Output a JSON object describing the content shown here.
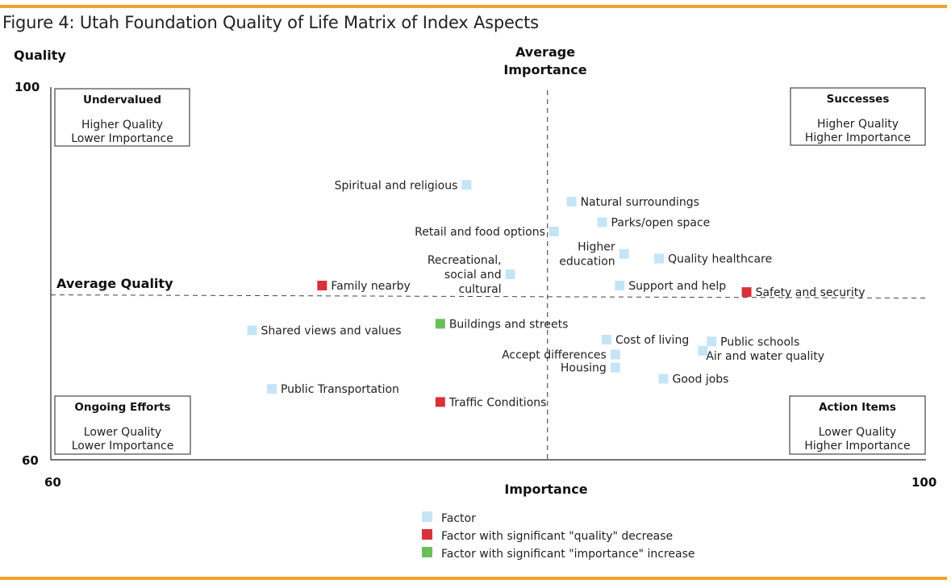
{
  "figure_title": "Figure 4: Utah Foundation Quality of Life Matrix of Index Aspects",
  "colors": {
    "accent_rule": "#f0a22a",
    "factor": "#c5e5f7",
    "quality_decrease": "#d9303a",
    "importance_increase": "#6abf5a"
  },
  "chart_data": {
    "type": "scatter",
    "title": "Figure 4: Utah Foundation Quality of Life Matrix of Index Aspects",
    "xlabel": "Importance",
    "ylabel": "Quality",
    "xlim": [
      60,
      100
    ],
    "ylim": [
      60,
      100
    ],
    "x_ticks": [
      "60",
      "100"
    ],
    "y_ticks": [
      "100",
      "60"
    ],
    "grid": false,
    "reference_lines": {
      "average_importance": {
        "label": "Average Importance",
        "value": 82.7
      },
      "average_quality": {
        "label": "Average Quality",
        "value": 77.7
      }
    },
    "quadrants": [
      {
        "id": "undervalued",
        "title": "Undervalued",
        "line1": "Higher Quality",
        "line2": "Lower Importance",
        "position": "top-left"
      },
      {
        "id": "successes",
        "title": "Successes",
        "line1": "Higher Quality",
        "line2": "Higher Importance",
        "position": "top-right"
      },
      {
        "id": "ongoing-efforts",
        "title": "Ongoing Efforts",
        "line1": "Lower Quality",
        "line2": "Lower Importance",
        "position": "bottom-left"
      },
      {
        "id": "action-items",
        "title": "Action Items",
        "line1": "Lower Quality",
        "line2": "Higher Importance",
        "position": "bottom-right"
      }
    ],
    "legend": {
      "placement": "bottom-center",
      "entries": [
        {
          "key": "factor",
          "label": "Factor"
        },
        {
          "key": "quality_decrease",
          "label": "Factor with significant \"quality\" decrease"
        },
        {
          "key": "importance_increase",
          "label": "Factor with significant \"importance\" increase"
        }
      ]
    },
    "points": [
      {
        "label": "Spiritual and religious",
        "lines": [
          "Spiritual and religious"
        ],
        "importance": 79.0,
        "quality": 89.5,
        "category": "factor",
        "label_side": "left"
      },
      {
        "label": "Natural surroundings",
        "lines": [
          "Natural surroundings"
        ],
        "importance": 83.8,
        "quality": 87.7,
        "category": "factor",
        "label_side": "right"
      },
      {
        "label": "Parks/open space",
        "lines": [
          "Parks/open space"
        ],
        "importance": 85.2,
        "quality": 85.5,
        "category": "factor",
        "label_side": "right"
      },
      {
        "label": "Retail and food options",
        "lines": [
          "Retail and food options"
        ],
        "importance": 83.0,
        "quality": 84.5,
        "category": "factor",
        "label_side": "left"
      },
      {
        "label": "Higher education",
        "lines": [
          "Higher",
          "education"
        ],
        "importance": 86.2,
        "quality": 82.1,
        "category": "factor",
        "label_side": "left"
      },
      {
        "label": "Quality healthcare",
        "lines": [
          "Quality healthcare"
        ],
        "importance": 87.8,
        "quality": 81.6,
        "category": "factor",
        "label_side": "right"
      },
      {
        "label": "Recreational, social and cultural",
        "lines": [
          "Recreational,",
          "social and",
          "cultural"
        ],
        "importance": 81.0,
        "quality": 79.9,
        "category": "factor",
        "label_side": "left"
      },
      {
        "label": "Family nearby",
        "lines": [
          "Family nearby"
        ],
        "importance": 72.4,
        "quality": 78.7,
        "category": "quality_decrease",
        "label_side": "right"
      },
      {
        "label": "Support and help",
        "lines": [
          "Support and help"
        ],
        "importance": 86.0,
        "quality": 78.7,
        "category": "factor",
        "label_side": "right"
      },
      {
        "label": "Safety and security",
        "lines": [
          "Safety and security"
        ],
        "importance": 91.8,
        "quality": 78.0,
        "category": "quality_decrease",
        "label_side": "right"
      },
      {
        "label": "Shared views and values",
        "lines": [
          "Shared views and values"
        ],
        "importance": 69.2,
        "quality": 73.9,
        "category": "factor",
        "label_side": "right"
      },
      {
        "label": "Buildings and streets",
        "lines": [
          "Buildings and streets"
        ],
        "importance": 77.8,
        "quality": 74.6,
        "category": "importance_increase",
        "label_side": "right"
      },
      {
        "label": "Cost of living",
        "lines": [
          "Cost of living"
        ],
        "importance": 85.4,
        "quality": 72.9,
        "category": "factor",
        "label_side": "right"
      },
      {
        "label": "Public schools",
        "lines": [
          "Public schools"
        ],
        "importance": 90.2,
        "quality": 72.7,
        "category": "factor",
        "label_side": "right"
      },
      {
        "label": "Accept differences",
        "lines": [
          "Accept differences"
        ],
        "importance": 85.8,
        "quality": 71.3,
        "category": "factor",
        "label_side": "left"
      },
      {
        "label": "Air and water quality",
        "lines": [
          "Air and water quality"
        ],
        "importance": 89.8,
        "quality": 71.7,
        "category": "factor",
        "label_side": "right-below"
      },
      {
        "label": "Housing",
        "lines": [
          "Housing"
        ],
        "importance": 85.8,
        "quality": 69.9,
        "category": "factor",
        "label_side": "left"
      },
      {
        "label": "Good jobs",
        "lines": [
          "Good jobs"
        ],
        "importance": 88.0,
        "quality": 68.7,
        "category": "factor",
        "label_side": "right"
      },
      {
        "label": "Public Transportation",
        "lines": [
          "Public Transportation"
        ],
        "importance": 70.1,
        "quality": 67.6,
        "category": "factor",
        "label_side": "right"
      },
      {
        "label": "Traffic Conditions",
        "lines": [
          "Traffic Conditions"
        ],
        "importance": 77.8,
        "quality": 66.2,
        "category": "quality_decrease",
        "label_side": "right"
      }
    ]
  }
}
